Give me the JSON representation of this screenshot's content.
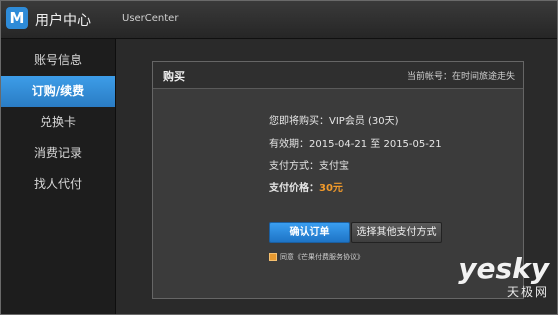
{
  "header": {
    "logo_letter": "M",
    "title": "用户中心",
    "subtitle": "UserCenter"
  },
  "sidebar": {
    "items": [
      {
        "label": "账号信息",
        "active": false
      },
      {
        "label": "订购/续费",
        "active": true
      },
      {
        "label": "兑换卡",
        "active": false
      },
      {
        "label": "消费记录",
        "active": false
      },
      {
        "label": "找人代付",
        "active": false
      }
    ]
  },
  "dialog": {
    "title": "购买",
    "current_account": "当前帐号：在时间旅途走失",
    "purchase_line": "您即将购买：VIP会员 (30天)",
    "validity_line": "有效期：2015-04-21 至 2015-05-21",
    "payment_method_line": "支付方式：支付宝",
    "price_label": "支付价格：",
    "price_value": "30元",
    "confirm_button": "确认订单",
    "other_payment_button": "选择其他支付方式",
    "agreement_text": "同意《芒果付费服务协议》",
    "agreement_checked": true
  },
  "watermark": {
    "main": "yesky",
    "sub": "天极网"
  },
  "colors": {
    "accent": "#2e8bd8",
    "price": "#f19a2b"
  }
}
